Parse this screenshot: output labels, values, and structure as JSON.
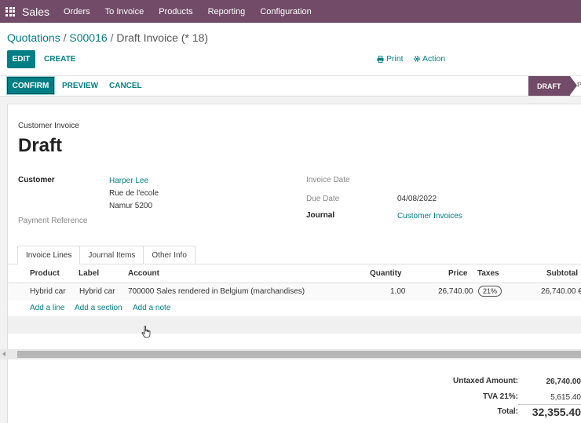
{
  "app": {
    "name": "Sales",
    "menu": [
      "Orders",
      "To Invoice",
      "Products",
      "Reporting",
      "Configuration"
    ]
  },
  "breadcrumb": {
    "level1": "Quotations",
    "sep": "/",
    "level2": "S00016",
    "current": "Draft Invoice (* 18)"
  },
  "toolbar": {
    "edit_label": "EDIT",
    "create_label": "CREATE",
    "print_label": "Print",
    "action_label": "Action"
  },
  "statusbar": {
    "confirm_label": "CONFIRM",
    "preview_label": "PREVIEW",
    "cancel_label": "CANCEL",
    "stage_current": "DRAFT",
    "stage_next": "P"
  },
  "invoice": {
    "type_label": "Customer Invoice",
    "title": "Draft",
    "customer_label": "Customer",
    "customer_name": "Harper Lee",
    "customer_address_1": "Rue de l'ecole",
    "customer_address_2": "Namur 5200",
    "payment_ref_label": "Payment Reference",
    "invoice_date_label": "Invoice Date",
    "due_date_label": "Due Date",
    "due_date_value": "04/08/2022",
    "journal_label": "Journal",
    "journal_value": "Customer Invoices"
  },
  "tabs": [
    "Invoice Lines",
    "Journal Items",
    "Other Info"
  ],
  "table": {
    "headers": {
      "product": "Product",
      "label": "Label",
      "account": "Account",
      "quantity": "Quantity",
      "price": "Price",
      "taxes": "Taxes",
      "subtotal": "Subtotal"
    },
    "rows": [
      {
        "product": "Hybrid car",
        "label": "Hybrid car",
        "account": "700000 Sales rendered in Belgium (marchandises)",
        "quantity": "1.00",
        "price": "26,740.00",
        "tax": "21%",
        "subtotal": "26,740.00 €"
      }
    ],
    "add_line": "Add a line",
    "add_section": "Add a section",
    "add_note": "Add a note"
  },
  "totals": {
    "untaxed_label": "Untaxed Amount:",
    "untaxed_value": "26,740.00",
    "tva_label": "TVA 21%:",
    "tva_value": "5,615.40",
    "total_label": "Total:",
    "total_value": "32,355.40"
  },
  "colors": {
    "brand": "#714b67",
    "accent": "#017e84"
  }
}
